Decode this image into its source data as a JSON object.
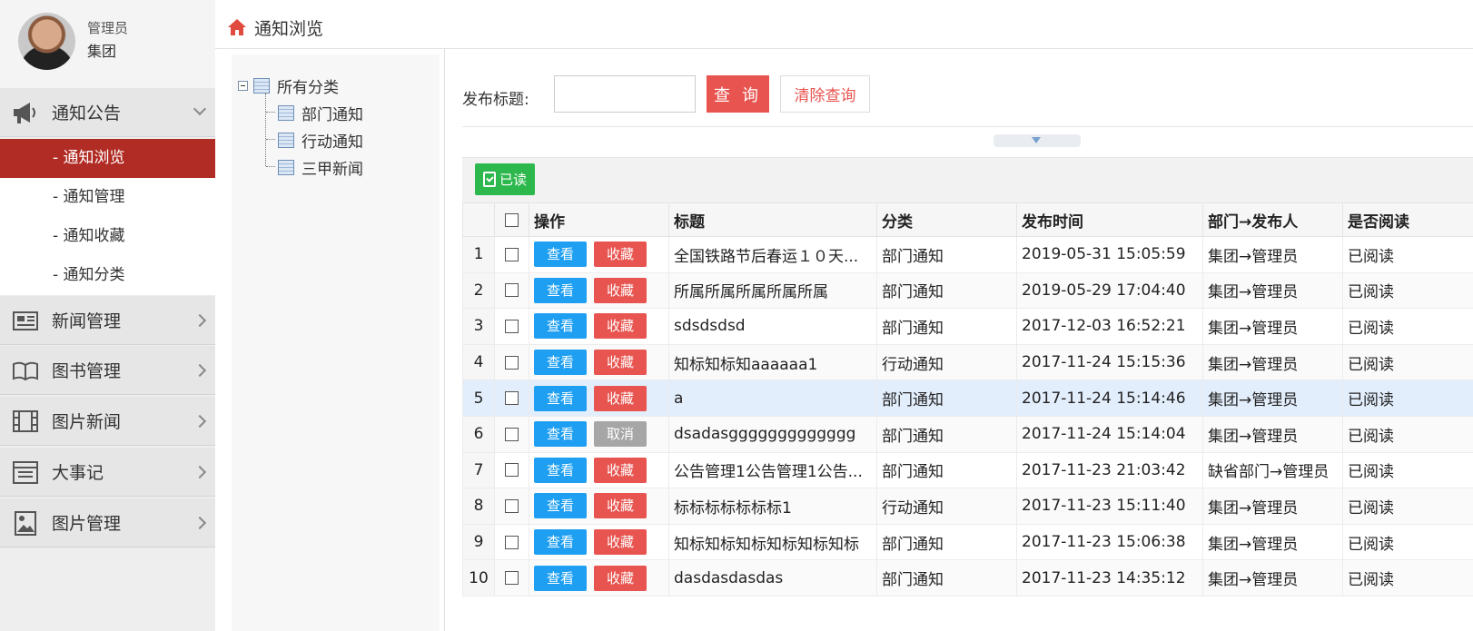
{
  "user": {
    "role": "管理员",
    "name": "集团"
  },
  "menu": {
    "notice": {
      "label": "通知公告",
      "icon": "megaphone-icon",
      "items": [
        "- 通知浏览",
        "- 通知管理",
        "- 通知收藏",
        "- 通知分类"
      ],
      "active_index": 0
    },
    "groups": [
      {
        "label": "新闻管理",
        "icon": "newspaper-icon"
      },
      {
        "label": "图书管理",
        "icon": "book-icon"
      },
      {
        "label": "图片新闻",
        "icon": "film-icon"
      },
      {
        "label": "大事记",
        "icon": "calendar-list-icon"
      },
      {
        "label": "图片管理",
        "icon": "image-icon"
      }
    ]
  },
  "header": {
    "title": "通知浏览",
    "icon": "home-icon"
  },
  "tree": {
    "root": "所有分类",
    "children": [
      "部门通知",
      "行动通知",
      "三甲新闻"
    ]
  },
  "search": {
    "label": "发布标题:",
    "value": "",
    "query_button": "查 询",
    "clear_button": "清除查询"
  },
  "toolbar": {
    "read_button": "已读"
  },
  "table": {
    "headers": [
      "操作",
      "标题",
      "分类",
      "发布时间",
      "部门→发布人",
      "是否阅读"
    ],
    "view_label": "查看",
    "rows": [
      {
        "no": "1",
        "title": "全国铁路节后春运１０天...",
        "category": "部门通知",
        "time": "2019-05-31 15:05:59",
        "dept": "集团→管理员",
        "read": "已阅读",
        "fav": "收藏"
      },
      {
        "no": "2",
        "title": "所属所属所属所属所属",
        "category": "部门通知",
        "time": "2019-05-29 17:04:40",
        "dept": "集团→管理员",
        "read": "已阅读",
        "fav": "收藏"
      },
      {
        "no": "3",
        "title": "sdsdsdsd",
        "category": "部门通知",
        "time": "2017-12-03 16:52:21",
        "dept": "集团→管理员",
        "read": "已阅读",
        "fav": "收藏"
      },
      {
        "no": "4",
        "title": "知标知标知aaaaaa1",
        "category": "行动通知",
        "time": "2017-11-24 15:15:36",
        "dept": "集团→管理员",
        "read": "已阅读",
        "fav": "收藏"
      },
      {
        "no": "5",
        "title": "a",
        "category": "部门通知",
        "time": "2017-11-24 15:14:46",
        "dept": "集团→管理员",
        "read": "已阅读",
        "fav": "收藏"
      },
      {
        "no": "6",
        "title": "dsadasggggggggggggg",
        "category": "部门通知",
        "time": "2017-11-24 15:14:04",
        "dept": "集团→管理员",
        "read": "已阅读",
        "fav": "取消"
      },
      {
        "no": "7",
        "title": "公告管理1公告管理1公告...",
        "category": "部门通知",
        "time": "2017-11-23 21:03:42",
        "dept": "缺省部门→管理员",
        "read": "已阅读",
        "fav": "收藏"
      },
      {
        "no": "8",
        "title": "标标标标标标标1",
        "category": "行动通知",
        "time": "2017-11-23 15:11:40",
        "dept": "集团→管理员",
        "read": "已阅读",
        "fav": "收藏"
      },
      {
        "no": "9",
        "title": "知标知标知标知标知标知标",
        "category": "部门通知",
        "time": "2017-11-23 15:06:38",
        "dept": "集团→管理员",
        "read": "已阅读",
        "fav": "收藏"
      },
      {
        "no": "10",
        "title": "dasdasdasdas",
        "category": "部门通知",
        "time": "2017-11-23 14:35:12",
        "dept": "集团→管理员",
        "read": "已阅读",
        "fav": "收藏"
      }
    ],
    "selected_row": 5
  },
  "colors": {
    "accent_red": "#b12c24",
    "button_red": "#e8544f",
    "button_blue": "#1e9ff2",
    "button_green": "#2db84e"
  }
}
